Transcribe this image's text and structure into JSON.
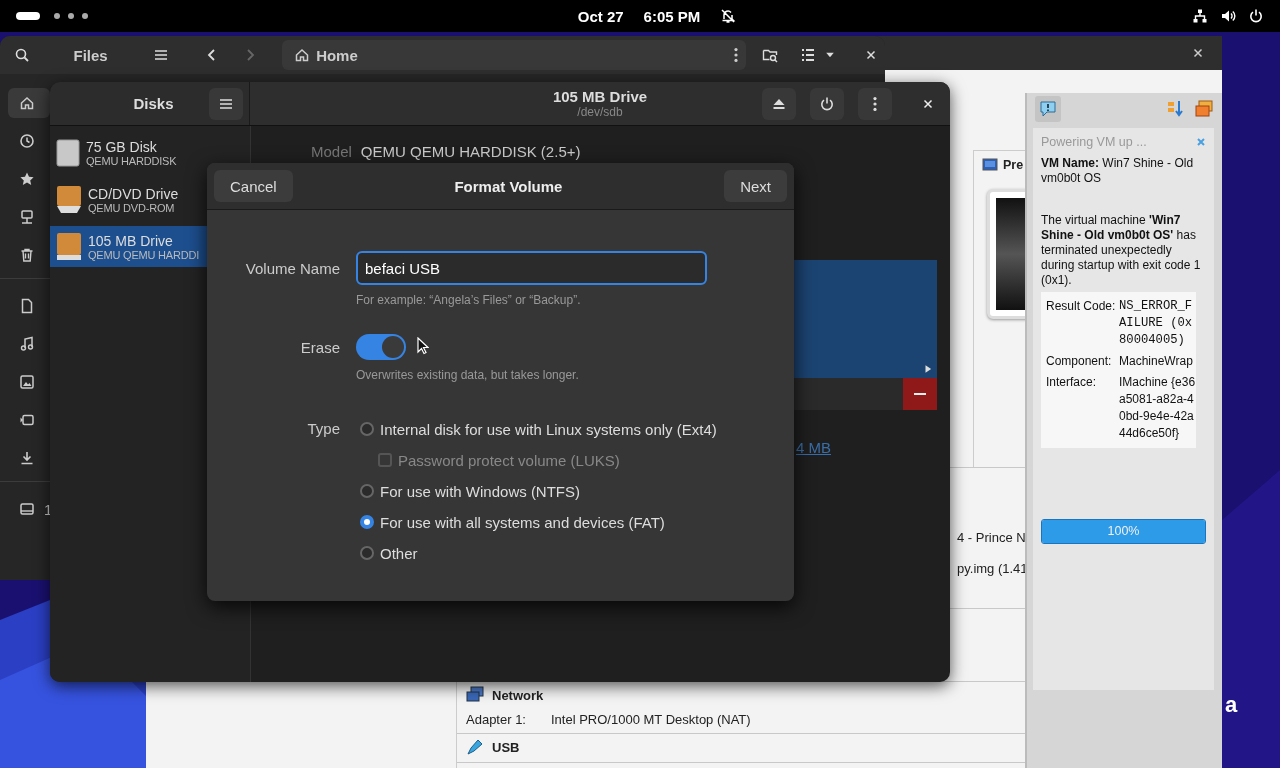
{
  "top_bar": {
    "date": "Oct 27",
    "time": "6:05 PM"
  },
  "files_window": {
    "title": "Files",
    "path": "Home",
    "sidebar": [
      {
        "items": [
          {
            "selected": true
          },
          {
            "selected": false
          },
          {
            "selected": false
          },
          {
            "selected": false
          },
          {
            "selected": false
          }
        ]
      },
      {
        "items": [
          {
            "selected": false
          },
          {
            "selected": false
          },
          {
            "selected": false
          },
          {
            "selected": false
          },
          {
            "selected": false
          }
        ]
      },
      {
        "items": [
          {
            "label": "1",
            "selected": false
          }
        ]
      }
    ]
  },
  "vbox_window": {
    "preview_heading": "Pre",
    "detail_fragments": [
      "4 - Prince N",
      "py.img (1.41"
    ],
    "network": {
      "heading": "Network",
      "label": "Adapter 1:",
      "value": "Intel PRO/1000 MT Desktop (NAT)"
    },
    "usb": {
      "heading": "USB"
    }
  },
  "disks_window": {
    "title": "Disks",
    "drive_title": "105 MB Drive",
    "drive_path": "/dev/sdb",
    "model_label": "Model",
    "model_value": "QEMU QEMU HARDDISK (2.5+)",
    "size_link": "4 MB",
    "drives": [
      {
        "name": "75 GB Disk",
        "model": "QEMU HARDDISK",
        "kind": "harddisk",
        "selected": false
      },
      {
        "name": "CD/DVD Drive",
        "model": "QEMU DVD-ROM",
        "kind": "optical",
        "selected": false
      },
      {
        "name": "105 MB Drive",
        "model": "QEMU QEMU HARDDI",
        "kind": "usb",
        "selected": true
      }
    ]
  },
  "format_dialog": {
    "title": "Format Volume",
    "cancel": "Cancel",
    "next": "Next",
    "volume_name_label": "Volume Name",
    "volume_name": "befaci USB",
    "volume_name_hint": "For example: “Angela’s Files” or “Backup”.",
    "erase_label": "Erase",
    "erase_on": true,
    "erase_hint": "Overwrites existing data, but takes longer.",
    "type_label": "Type",
    "options": [
      {
        "kind": "radio",
        "label": "Internal disk for use with Linux systems only (Ext4)",
        "selected": false
      },
      {
        "kind": "checkbox",
        "label": "Password protect volume (LUKS)",
        "checked": false,
        "disabled": true
      },
      {
        "kind": "radio",
        "label": "For use with Windows (NTFS)",
        "selected": false
      },
      {
        "kind": "radio",
        "label": "For use with all systems and devices (FAT)",
        "selected": true
      },
      {
        "kind": "radio",
        "label": "Other",
        "selected": false
      }
    ]
  },
  "vm_popup": {
    "status": "Powering VM up ...",
    "vm_name": "**VM Name:** Win7 Shine - Old vm0b0t OS",
    "message": "The virtual machine **'Win7 Shine - Old vm0b0t OS'** has terminated unexpectedly during startup with exit code 1 (0x1).",
    "details": [
      {
        "label": "Result Code:",
        "value": "NS_ERROR_FAILURE (0x80004005)",
        "kind": "mono"
      },
      {
        "label": "Component:",
        "value": "MachineWrap",
        "kind": "text"
      },
      {
        "label": "Interface:",
        "value": "IMachine {e36a5081-a82a-40bd-9e4e-42a44d6ce50f}",
        "kind": "text"
      }
    ],
    "progress": {
      "level": 1,
      "label": "100%"
    }
  },
  "desktop": {
    "corner_text": "a"
  }
}
